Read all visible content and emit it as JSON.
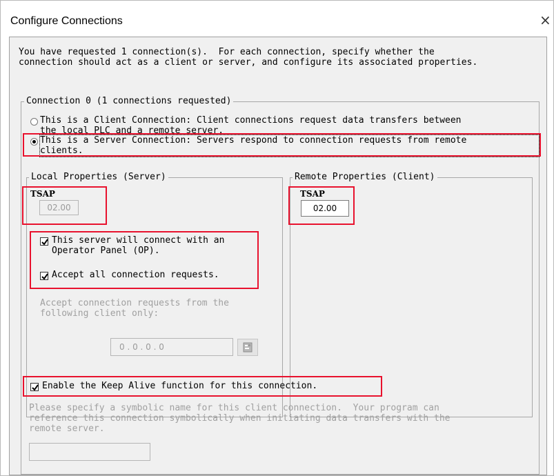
{
  "window": {
    "title": "Configure Connections",
    "close_glyph": "×"
  },
  "intro": [
    "You have requested 1 connection(s).  For each connection, specify whether the",
    "connection should act as a client or server, and configure its associated properties."
  ],
  "connection_group": {
    "legend": "Connection 0 (1 connections requested)",
    "client_option": {
      "lines": [
        "This is a Client Connection: Client connections request data transfers between",
        "the local PLC and a remote server."
      ],
      "selected": false
    },
    "server_option": {
      "lines": [
        "This is a Server Connection: Servers respond to connection requests from remote",
        "clients."
      ],
      "selected": true
    }
  },
  "local": {
    "legend": "Local Properties (Server)",
    "tsap_label": "TSAP",
    "tsap_value": "02.00",
    "op_checkbox": {
      "lines": [
        "This server will connect with an",
        "Operator Panel (OP)."
      ],
      "checked": true
    },
    "accept_all_checkbox": {
      "label": "Accept all connection requests.",
      "checked": true
    },
    "accept_from": [
      "Accept connection requests from the",
      "following client only:"
    ],
    "ip_value": "0 . 0 . 0 . 0",
    "ip_button_icon": "address-book-icon"
  },
  "remote": {
    "legend": "Remote Properties (Client)",
    "tsap_label": "TSAP",
    "tsap_value": "02.00"
  },
  "keep_alive": {
    "label": "Enable the Keep Alive function for this connection.",
    "checked": true
  },
  "symbolic": {
    "lines": [
      "Please specify a symbolic name for this client connection.  Your program can",
      "reference this connection symbolically when initiating data transfers with the",
      "remote server."
    ],
    "value": ""
  },
  "colors": {
    "highlight": "#e8112d",
    "dialog_bg": "#f0f0f0",
    "disabled_text": "#a0a0a0"
  }
}
